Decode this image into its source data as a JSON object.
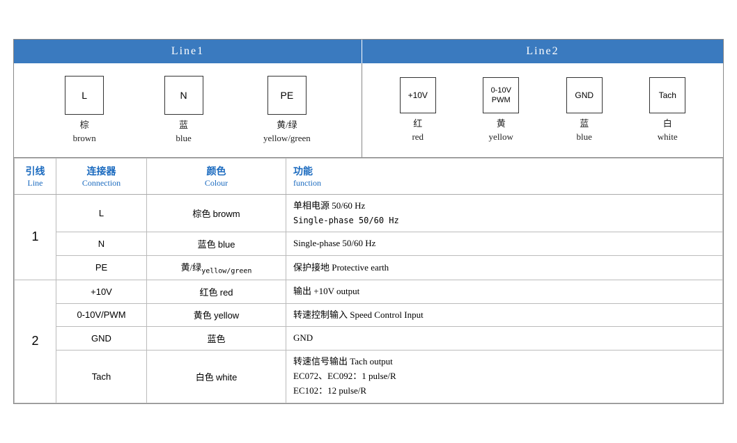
{
  "header": {
    "line1_label": "Line1",
    "line2_label": "Line2"
  },
  "line1_connectors": [
    {
      "box_label": "L",
      "zh": "棕",
      "en": "brown"
    },
    {
      "box_label": "N",
      "zh": "蓝",
      "en": "blue"
    },
    {
      "box_label": "PE",
      "zh": "黄/绿",
      "en": "yellow/green"
    }
  ],
  "line2_connectors": [
    {
      "box_label": "+10V",
      "zh": "红",
      "en": "red"
    },
    {
      "box_label": "0-10V\nPWM",
      "zh": "黄",
      "en": "yellow"
    },
    {
      "box_label": "GND",
      "zh": "蓝",
      "en": "blue"
    },
    {
      "box_label": "Tach",
      "zh": "白",
      "en": "white"
    }
  ],
  "table": {
    "headers": {
      "line": {
        "zh": "引线",
        "en": "Line"
      },
      "connection": {
        "zh": "连接器",
        "en": "Connection"
      },
      "colour": {
        "zh": "颜色",
        "en": "Colour"
      },
      "function": {
        "zh": "功能",
        "en": "function"
      }
    },
    "rows": [
      {
        "line": "1",
        "line_rowspan": 3,
        "connection": "L",
        "colour_zh": "棕色",
        "colour_en": "browm",
        "function": "单相电源 50/60 Hz\nSingle-phase 50/60 Hz"
      },
      {
        "line": "",
        "connection": "N",
        "colour_zh": "蓝色",
        "colour_en": "blue",
        "function": "Single-phase 50/60 Hz"
      },
      {
        "line": "",
        "connection": "PE",
        "colour_zh": "黄/绿",
        "colour_en": "yellow/green",
        "function": "保护接地 Protective earth"
      },
      {
        "line": "2",
        "line_rowspan": 4,
        "connection": "+10V",
        "colour_zh": "红色",
        "colour_en": "red",
        "function": "输出 +10V output"
      },
      {
        "line": "",
        "connection": "0-10V/PWM",
        "colour_zh": "黄色",
        "colour_en": "yellow",
        "function": "转速控制输入 Speed Control Input"
      },
      {
        "line": "",
        "connection": "GND",
        "colour_zh": "蓝色",
        "colour_en": "",
        "function": "GND"
      },
      {
        "line": "",
        "connection": "Tach",
        "colour_zh": "白色",
        "colour_en": "white",
        "function": "转速信号输出 Tach output\nEC072、EC092：1 pulse/R\nEC102：12 pulse/R"
      }
    ]
  }
}
